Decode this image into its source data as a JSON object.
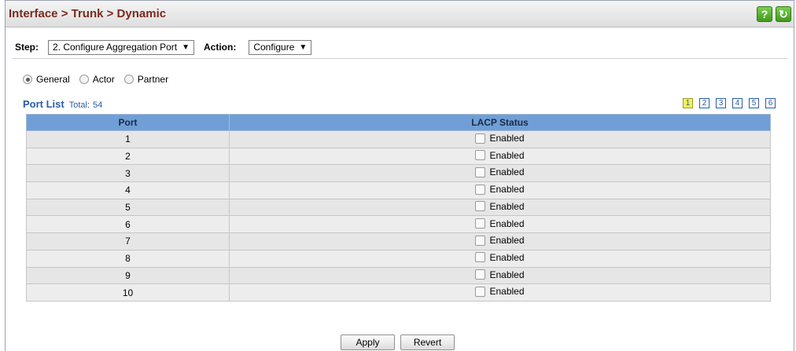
{
  "header": {
    "title": "Interface > Trunk > Dynamic",
    "help_label": "?",
    "refresh_label": "↻"
  },
  "step": {
    "label": "Step:",
    "value": "2. Configure Aggregation Port",
    "caret": "▼"
  },
  "action": {
    "label": "Action:",
    "value": "Configure",
    "caret": "▼"
  },
  "view_options": [
    {
      "label": "General",
      "selected": true
    },
    {
      "label": "Actor",
      "selected": false
    },
    {
      "label": "Partner",
      "selected": false
    }
  ],
  "port_list": {
    "title": "Port List",
    "total_label": "Total:",
    "total": "54",
    "pages": [
      "1",
      "2",
      "3",
      "4",
      "5",
      "6"
    ],
    "active_page": "1",
    "columns": [
      "Port",
      "LACP Status"
    ],
    "rows": [
      {
        "port": "1",
        "status": "Enabled",
        "checked": false
      },
      {
        "port": "2",
        "status": "Enabled",
        "checked": false
      },
      {
        "port": "3",
        "status": "Enabled",
        "checked": false
      },
      {
        "port": "4",
        "status": "Enabled",
        "checked": false
      },
      {
        "port": "5",
        "status": "Enabled",
        "checked": false
      },
      {
        "port": "6",
        "status": "Enabled",
        "checked": false
      },
      {
        "port": "7",
        "status": "Enabled",
        "checked": false
      },
      {
        "port": "8",
        "status": "Enabled",
        "checked": false
      },
      {
        "port": "9",
        "status": "Enabled",
        "checked": false
      },
      {
        "port": "10",
        "status": "Enabled",
        "checked": false
      }
    ]
  },
  "buttons": {
    "apply": "Apply",
    "revert": "Revert"
  }
}
